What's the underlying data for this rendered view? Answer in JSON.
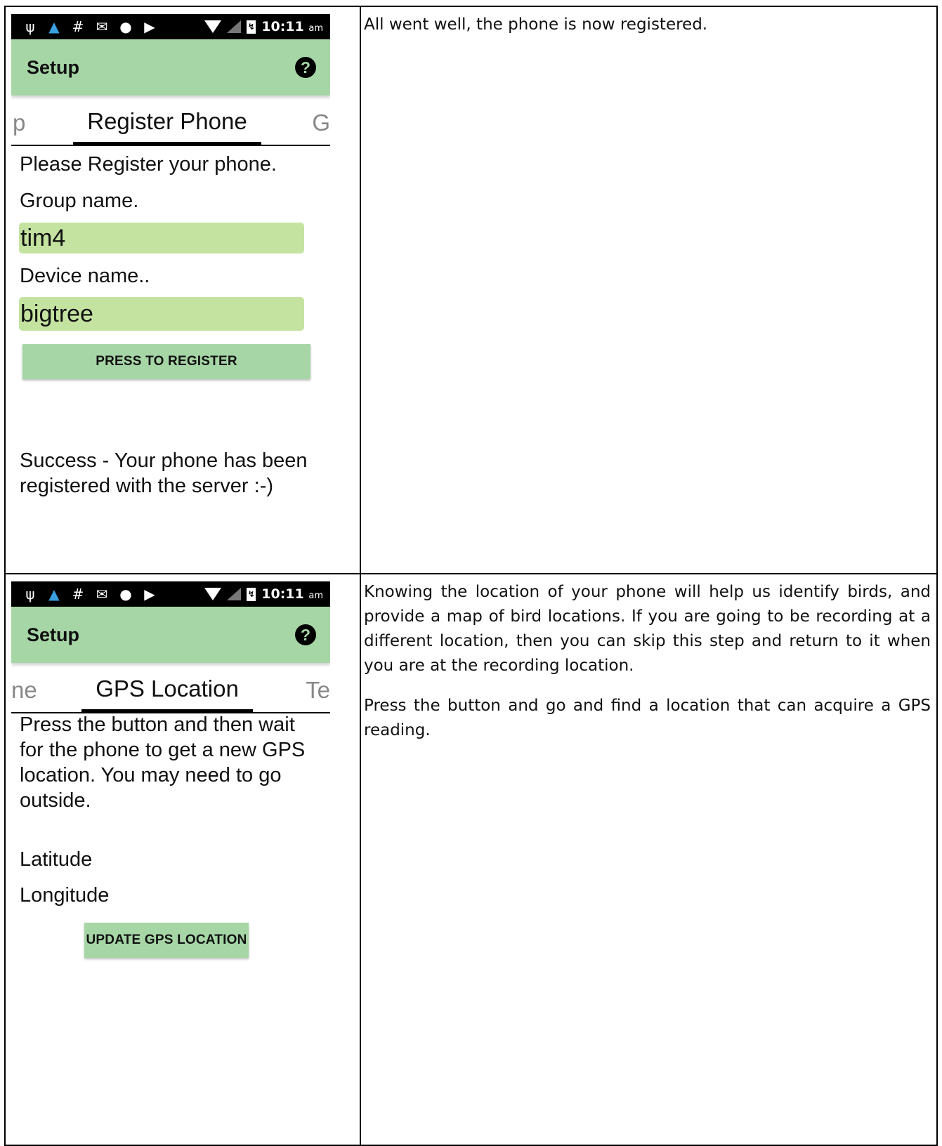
{
  "screen1": {
    "status_time": "10:11",
    "status_ampm": "am",
    "app_title": "Setup",
    "help_icon": "?",
    "tab_prev_fragment": "p",
    "tab_active": "Register Phone",
    "tab_next_fragment": "G",
    "intro": "Please Register your phone.",
    "group_label": "Group name.",
    "group_value": "tim4",
    "device_label": "Device name..",
    "device_value": "bigtree",
    "register_button": "PRESS TO REGISTER",
    "success_line1": "Success - Your phone has been",
    "success_line2": "registered with the server :-)"
  },
  "description1": "All went well, the phone is now registered.",
  "screen2": {
    "status_time": "10:11",
    "status_ampm": "am",
    "app_title": "Setup",
    "help_icon": "?",
    "tab_prev_fragment": "ne",
    "tab_active": "GPS Location",
    "tab_next_fragment": "Te",
    "instruction_line1": "Press the button and then wait",
    "instruction_line2": "for the phone to get a new GPS",
    "instruction_line3": "location. You may need to go",
    "instruction_line4": "outside.",
    "latitude_label": "Latitude",
    "longitude_label": "Longitude",
    "update_button": "UPDATE GPS LOCATION"
  },
  "description2": {
    "paragraph1": "Knowing the location of your phone will help us identify birds, and provide a map of bird locations. If you are going to be recording at a different location, then you can skip this step and return to it when you are at the recording location.",
    "paragraph2": "Press the button and go and find a location that can acquire a GPS reading."
  },
  "status_icons": [
    "usb-icon",
    "upload-icon",
    "hash-icon",
    "gmail-icon",
    "android-icon",
    "play-store-icon",
    "wifi-icon",
    "signal-icon",
    "battery-icon"
  ],
  "colors": {
    "app_bar": "#a6d6a6",
    "input_field": "#c4e3a0",
    "status_bar": "#000000"
  }
}
